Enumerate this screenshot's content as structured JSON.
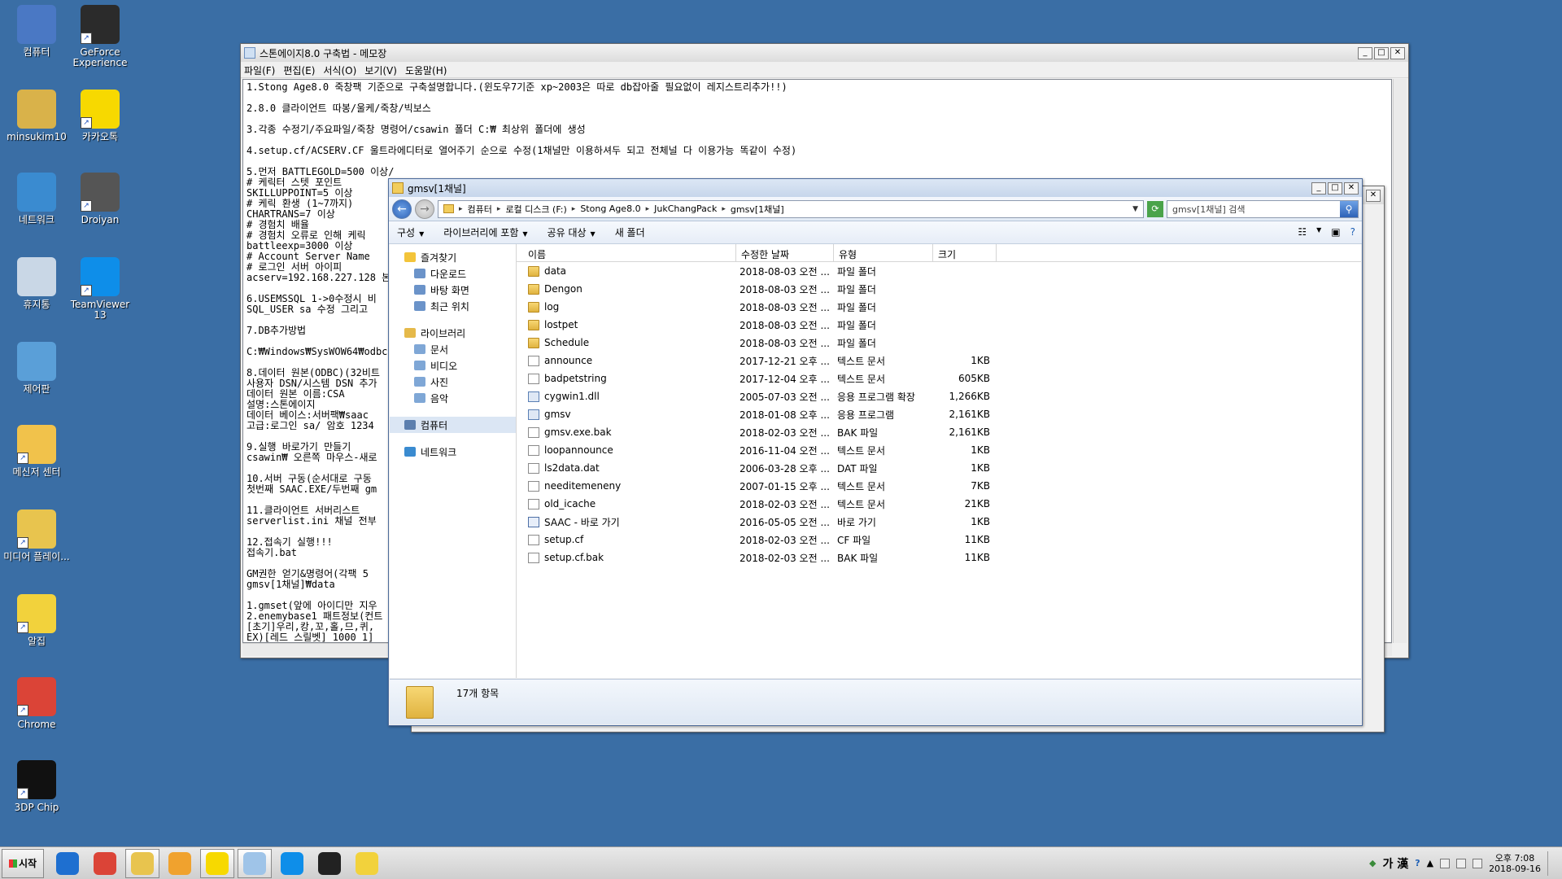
{
  "desktop": {
    "icons": [
      {
        "label": "컴퓨터",
        "icon": "computer-icon",
        "color": "#4a78c4"
      },
      {
        "label": "GeForce Experience",
        "icon": "geforce-icon",
        "color": "#2b2b2b"
      },
      {
        "label": "minsukim10",
        "icon": "user-folder-icon",
        "color": "#d9b24a"
      },
      {
        "label": "카카오톡",
        "icon": "kakaotalk-icon",
        "color": "#f7d900"
      },
      {
        "label": "네트워크",
        "icon": "network-icon",
        "color": "#3a8bd0"
      },
      {
        "label": "Droiyan",
        "icon": "droiyan-icon",
        "color": "#555555"
      },
      {
        "label": "휴지통",
        "icon": "recycle-bin-icon",
        "color": "#c9d7e6"
      },
      {
        "label": "TeamViewer 13",
        "icon": "teamviewer-icon",
        "color": "#0e8ee9"
      },
      {
        "label": "제어판",
        "icon": "control-panel-icon",
        "color": "#5a9fd8"
      },
      {
        "label": "메신저 센터",
        "icon": "messenger-center-icon",
        "color": "#f1c24b"
      },
      {
        "label": "미디어 플레이...",
        "icon": "media-player-icon",
        "color": "#e8c44e"
      },
      {
        "label": "알집",
        "icon": "alzip-icon",
        "color": "#f2d23c"
      },
      {
        "label": "Chrome",
        "icon": "chrome-icon",
        "color": "#db4437"
      },
      {
        "label": "3DP Chip",
        "icon": "3dp-chip-icon",
        "color": "#111111"
      }
    ]
  },
  "notepad": {
    "title": "스톤에이지8.0 구축법 - 메모장",
    "menu": [
      "파일(F)",
      "편집(E)",
      "서식(O)",
      "보기(V)",
      "도움말(H)"
    ],
    "lines": [
      "1.Stong Age8.0 죽창팩 기준으로 구축설명합니다.(윈도우7기준 xp~2003은 따로 db잡아줄 필요없이 레지스트리추가!!)",
      "",
      "2.8.0 클라이언트 따봉/울케/죽창/빅보스",
      "",
      "3.각종 수정기/주요파일/죽창 명령어/csawin 폴더 C:₩ 최상위 폴더에 생성",
      "",
      "4.setup.cf/ACSERV.CF 울트라에디터로 열어주기 순으로 수정(1채널만 이용하셔두 되고 전체널 다 이용가능 똑같이 수정)",
      "",
      "5.먼저 BATTLEGOLD=500 이상/",
      "# 케릭터 스텟 포인트",
      "SKILLUPPOINT=5 이상",
      "# 케릭 환생 (1~7까지)",
      "CHARTRANS=7 이상",
      "# 경험치 배율",
      "# 경험치 오류로 인해 케릭",
      "battleexp=3000 이상",
      "# Account Server Name",
      "# 로그인 서버 아이피",
      "acserv=192.168.227.128 본",
      "",
      "6.USEMSSQL 1->0수정시 비",
      "SQL_USER sa 수정 그리고 ",
      "",
      "7.DB추가방법",
      "",
      "C:₩Windows₩SysWOW64₩odbca",
      "",
      "8.데이터 원본(ODBC)(32비트",
      "사용자 DSN/시스템 DSN 추가",
      "데이터 원본 이름:CSA",
      "설명:스톤에이지",
      "데이터 베이스:서버팩₩saac",
      "고급:로그인 sa/ 암호 1234",
      "",
      "9.실행 바로가기 만들기",
      "csawin₩ 오른쪽 마우스-새로",
      "",
      "10.서버 구동(순서대로 구동",
      "첫번째 SAAC.EXE/두번째 gm",
      "",
      "11.클라이언트 서버리스트",
      "serverlist.ini 채널 전부",
      "",
      "12.접속기 실행!!!",
      "접속기.bat",
      "",
      "GM권한 얻기&명령어(각팩 5",
      "gmsv[1채널]₩data",
      "",
      "1.gmset(앞에 아이디만 지우",
      "2.enemybase1 패트정보(컨트",
      "[초기]우리,캉,꼬,홀,므,퀴,",
      "EX)[레드 스릴벳] 1000 1]"
    ]
  },
  "explorer": {
    "title": "gmsv[1채널]",
    "breadcrumb": [
      "컴퓨터",
      "로컬 디스크 (F:)",
      "Stong Age8.0",
      "JukChangPack",
      "gmsv[1채널]"
    ],
    "search_placeholder": "gmsv[1채널] 검색",
    "toolbar": [
      "구성",
      "라이브러리에 포함",
      "공유 대상",
      "새 폴더"
    ],
    "nav": {
      "favorites": "즐겨찾기",
      "favorites_items": [
        "다운로드",
        "바탕 화면",
        "최근 위치"
      ],
      "libraries": "라이브러리",
      "libraries_items": [
        "문서",
        "비디오",
        "사진",
        "음악"
      ],
      "computer": "컴퓨터",
      "network": "네트워크"
    },
    "columns": [
      "이름",
      "수정한 날짜",
      "유형",
      "크기"
    ],
    "files": [
      {
        "name": "data",
        "date": "2018-08-03 오전 ...",
        "type": "파일 폴더",
        "size": "",
        "icon": "folder"
      },
      {
        "name": "Dengon",
        "date": "2018-08-03 오전 ...",
        "type": "파일 폴더",
        "size": "",
        "icon": "folder"
      },
      {
        "name": "log",
        "date": "2018-08-03 오전 ...",
        "type": "파일 폴더",
        "size": "",
        "icon": "folder"
      },
      {
        "name": "lostpet",
        "date": "2018-08-03 오전 ...",
        "type": "파일 폴더",
        "size": "",
        "icon": "folder"
      },
      {
        "name": "Schedule",
        "date": "2018-08-03 오전 ...",
        "type": "파일 폴더",
        "size": "",
        "icon": "folder"
      },
      {
        "name": "announce",
        "date": "2017-12-21 오후 ...",
        "type": "텍스트 문서",
        "size": "1KB",
        "icon": "doc"
      },
      {
        "name": "badpetstring",
        "date": "2017-12-04 오후 ...",
        "type": "텍스트 문서",
        "size": "605KB",
        "icon": "doc"
      },
      {
        "name": "cygwin1.dll",
        "date": "2005-07-03 오전 ...",
        "type": "응용 프로그램 확장",
        "size": "1,266KB",
        "icon": "app"
      },
      {
        "name": "gmsv",
        "date": "2018-01-08 오후 ...",
        "type": "응용 프로그램",
        "size": "2,161KB",
        "icon": "app"
      },
      {
        "name": "gmsv.exe.bak",
        "date": "2018-02-03 오전 ...",
        "type": "BAK 파일",
        "size": "2,161KB",
        "icon": "doc"
      },
      {
        "name": "loopannounce",
        "date": "2016-11-04 오전 ...",
        "type": "텍스트 문서",
        "size": "1KB",
        "icon": "doc"
      },
      {
        "name": "ls2data.dat",
        "date": "2006-03-28 오후 ...",
        "type": "DAT 파일",
        "size": "1KB",
        "icon": "doc"
      },
      {
        "name": "needitemeneny",
        "date": "2007-01-15 오후 ...",
        "type": "텍스트 문서",
        "size": "7KB",
        "icon": "doc"
      },
      {
        "name": "old_icache",
        "date": "2018-02-03 오전 ...",
        "type": "텍스트 문서",
        "size": "21KB",
        "icon": "doc"
      },
      {
        "name": "SAAC - 바로 가기",
        "date": "2016-05-05 오전 ...",
        "type": "바로 가기",
        "size": "1KB",
        "icon": "lnk"
      },
      {
        "name": "setup.cf",
        "date": "2018-02-03 오전 ...",
        "type": "CF 파일",
        "size": "11KB",
        "icon": "doc"
      },
      {
        "name": "setup.cf.bak",
        "date": "2018-02-03 오전 ...",
        "type": "BAK 파일",
        "size": "11KB",
        "icon": "doc"
      }
    ],
    "status": "17개 항목"
  },
  "taskbar": {
    "start_label": "시작",
    "apps": [
      {
        "icon": "internet-explorer-icon",
        "color": "#1e6fd0"
      },
      {
        "icon": "chrome-icon",
        "color": "#db4437"
      },
      {
        "icon": "explorer-icon",
        "color": "#e8c44e"
      },
      {
        "icon": "media-player-icon",
        "color": "#f0a22e"
      },
      {
        "icon": "kakaotalk-icon",
        "color": "#f7d900"
      },
      {
        "icon": "notepad-icon",
        "color": "#9fc4e8"
      },
      {
        "icon": "teamviewer-icon",
        "color": "#0e8ee9"
      },
      {
        "icon": "ultraedit-icon",
        "color": "#222222"
      },
      {
        "icon": "alzip-icon",
        "color": "#f2d23c"
      }
    ],
    "ime": "가 漢",
    "clock_time": "오후 7:08",
    "clock_date": "2018-09-16"
  }
}
